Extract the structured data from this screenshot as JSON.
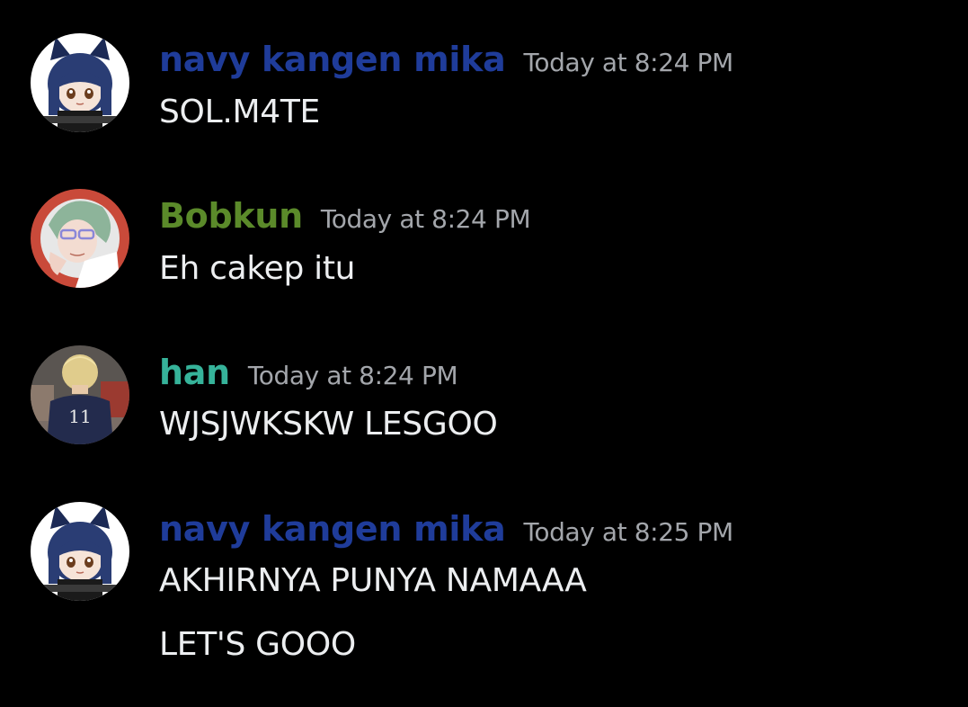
{
  "messages": [
    {
      "author": "navy kangen mika",
      "author_color": "#1f3c9a",
      "avatar": "anime-girl-cat-ears-avatar",
      "timestamp": "Today at 8:24 PM",
      "lines": [
        "SOL.M4TE"
      ]
    },
    {
      "author": "Bobkun",
      "author_color": "#5b8a2a",
      "avatar": "anime-boy-glasses-avatar",
      "timestamp": "Today at 8:24 PM",
      "lines": [
        "Eh cakep itu"
      ]
    },
    {
      "author": "han",
      "author_color": "#36b39a",
      "avatar": "volleyball-player-11-avatar",
      "avatar_text": "11",
      "timestamp": "Today at 8:24 PM",
      "lines": [
        "WJSJWKSKW LESGOO"
      ]
    },
    {
      "author": "navy kangen mika",
      "author_color": "#1f3c9a",
      "avatar": "anime-girl-cat-ears-avatar",
      "timestamp": "Today at 8:25 PM",
      "lines": [
        "AKHIRNYA PUNYA NAMAAA",
        "LET'S GOOO"
      ]
    }
  ]
}
